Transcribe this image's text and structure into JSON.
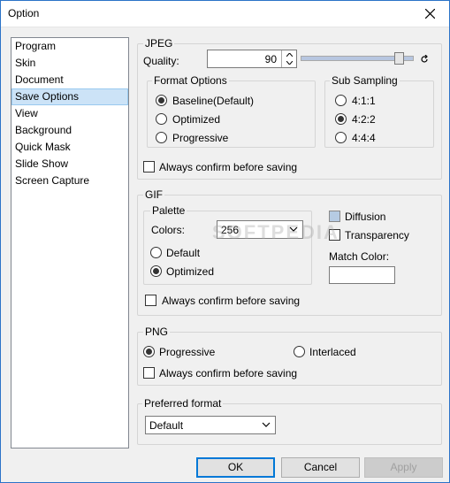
{
  "window": {
    "title": "Option"
  },
  "sidebar": {
    "items": [
      "Program",
      "Skin",
      "Document",
      "Save Options",
      "View",
      "Background",
      "Quick Mask",
      "Slide Show",
      "Screen Capture"
    ],
    "selected": "Save Options"
  },
  "jpeg": {
    "legend": "JPEG",
    "quality_label": "Quality:",
    "quality_value": "90",
    "quality_slider_fraction": 0.9,
    "format_options": {
      "legend": "Format Options",
      "options": [
        "Baseline(Default)",
        "Optimized",
        "Progressive"
      ],
      "selected": "Baseline(Default)"
    },
    "sub_sampling": {
      "legend": "Sub Sampling",
      "options": [
        "4:1:1",
        "4:2:2",
        "4:4:4"
      ],
      "selected": "4:2:2"
    },
    "confirm_label": "Always confirm before saving"
  },
  "gif": {
    "legend": "GIF",
    "palette": {
      "legend": "Palette",
      "colors_label": "Colors:",
      "colors_value": "256",
      "options": [
        "Default",
        "Optimized"
      ],
      "selected": "Optimized"
    },
    "diffusion_label": "Diffusion",
    "transparency_label": "Transparency",
    "match_color_label": "Match Color:",
    "confirm_label": "Always confirm before saving"
  },
  "png": {
    "legend": "PNG",
    "progressive_label": "Progressive",
    "interlaced_label": "Interlaced",
    "selected": "Progressive",
    "confirm_label": "Always confirm before saving"
  },
  "preferred": {
    "legend": "Preferred format",
    "value": "Default"
  },
  "buttons": {
    "ok": "OK",
    "cancel": "Cancel",
    "apply": "Apply"
  },
  "watermark": "SOFTPEDIA",
  "colors": {
    "accent": "#0078d7",
    "selection": "#cce3f7"
  },
  "icons": {
    "close": "close-icon",
    "reset": "reset-icon",
    "spin_up": "spin-up-icon",
    "spin_down": "spin-down-icon",
    "dropdown": "chevron-down-icon"
  }
}
